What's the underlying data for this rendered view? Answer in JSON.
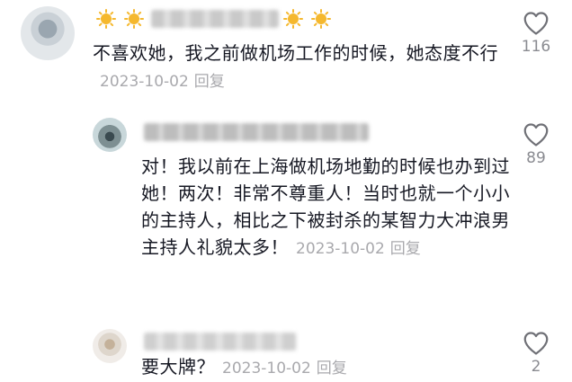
{
  "comments": [
    {
      "text": "不喜欢她，我之前做机场工作的时候，她态度不行",
      "date": "2023-10-02",
      "reply_label": "回复",
      "likes": "116"
    },
    {
      "text": "对！我以前在上海做机场地勤的时候也办到过她！两次！非常不尊重人！当时也就一个小小的主持人，相比之下被封杀的某智力大冲浪男主持人礼貌太多！",
      "date": "2023-10-02",
      "reply_label": "回复",
      "likes": "89"
    },
    {
      "text": "要大牌？",
      "date": "2023-10-02",
      "reply_label": "回复",
      "likes": "2"
    }
  ],
  "icons": {
    "like": "heart-outline-icon",
    "emoji": "sun-emoji-icon"
  },
  "colors": {
    "text": "#161823",
    "meta": "#a9a9ad",
    "like_count": "#8a8b91",
    "sun": "#f5b82e"
  }
}
